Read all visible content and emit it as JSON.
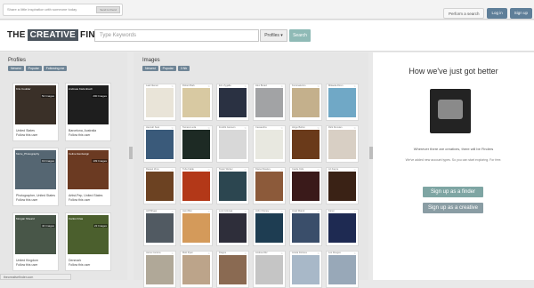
{
  "topbar": {
    "share_text": "Share a little inspiration with someone today",
    "share_button": "Send to friend",
    "perform_search": "Perform a search",
    "login": "Log in",
    "signup": "Sign up"
  },
  "header": {
    "logo_left": "THE",
    "logo_mid": "CREATIVE",
    "logo_right": "FINDER",
    "search_placeholder": "Type Keywords",
    "select_value": "Profiles",
    "search_button": "Search"
  },
  "profiles": {
    "title": "Profiles",
    "filters": [
      "Newest",
      "Popular",
      "Following me"
    ],
    "cards": [
      {
        "name": "Kris Coulder",
        "count": "52 Images",
        "location": "United States",
        "follow": "Follow this user",
        "color": "#3a3028"
      },
      {
        "name": "Andreas Kiefenbach",
        "count": "200 Images",
        "location": "Barcelona, Australia",
        "follow": "Follow this user",
        "color": "#1e1e1e"
      },
      {
        "name": "Moire_Photography",
        "count": "19 Images",
        "location": "Photographer, United States",
        "follow": "Follow this user",
        "color": "#556672"
      },
      {
        "name": "Celine Ikerdesign",
        "count": "109 Images",
        "location": "Artist-Pep, United States",
        "follow": "Follow this user",
        "color": "#6b3a22"
      },
      {
        "name": "Morgan Sheard",
        "count": "44 Images",
        "location": "United Kingdom",
        "follow": "Follow this user",
        "color": "#485648"
      },
      {
        "name": "Carlos Frias",
        "count": "22 Images",
        "location": "Denmark",
        "follow": "Follow this user",
        "color": "#4b5f2d"
      }
    ]
  },
  "images": {
    "title": "Images",
    "filters": [
      "Newest",
      "Popular",
      "3 Nb"
    ],
    "cards": [
      {
        "name": "Lael Niemer",
        "color": "#e9e4d8"
      },
      {
        "name": "Robert Bark",
        "color": "#d8c9a2"
      },
      {
        "name": "Eric Zygalla",
        "color": "#2a3142"
      },
      {
        "name": "Alex Broad",
        "color": "#a2a3a5"
      },
      {
        "name": "Kuroinaturino",
        "color": "#c4b08c"
      },
      {
        "name": "Mikaela Ahren",
        "color": "#70a8c6"
      },
      {
        "name": "Hannah Seet",
        "color": "#3a5a7a"
      },
      {
        "name": "Tamara Luda",
        "color": "#1d2a24"
      },
      {
        "name": "Fredrik Jansson",
        "color": "#d8d8d8"
      },
      {
        "name": "Cassandra",
        "color": "#e8e8e0"
      },
      {
        "name": "Hinge Bellon",
        "color": "#6a3a1a"
      },
      {
        "name": "Rick Dunstan",
        "color": "#d8cfc4"
      },
      {
        "name": "Raquel Zimo",
        "color": "#6c4222"
      },
      {
        "name": "Tubs Fable",
        "color": "#b33818"
      },
      {
        "name": "Tayler Wicker",
        "color": "#2c4650"
      },
      {
        "name": "Diana Sheeley",
        "color": "#8c5a3a"
      },
      {
        "name": "Castle Kids",
        "color": "#3a1a1a"
      },
      {
        "name": "Art Fayne",
        "color": "#3a2215"
      },
      {
        "name": "Jeff Briggs",
        "color": "#515a62"
      },
      {
        "name": "Jami Bon",
        "color": "#d49a5a"
      },
      {
        "name": "Luis Colunga",
        "color": "#2e2e3a"
      },
      {
        "name": "John Cheney",
        "color": "#1e3d52"
      },
      {
        "name": "Josef Marek",
        "color": "#3a4e6a"
      },
      {
        "name": "Karen",
        "color": "#1e2a52"
      },
      {
        "name": "Jaime Carrera",
        "color": "#b0a898"
      },
      {
        "name": "Matt Ryan",
        "color": "#bca48a"
      },
      {
        "name": "Diagne",
        "color": "#8a6a52"
      },
      {
        "name": "Andrea Ditz",
        "color": "#c5c5c5"
      },
      {
        "name": "Aniela Dolores",
        "color": "#a8b8c8"
      },
      {
        "name": "Les Rouges",
        "color": "#98a8b8"
      }
    ]
  },
  "promo": {
    "title": "How we've just got better",
    "sub1": "Wherever there are creatives, there will be Finders",
    "sub2": "We've added new account types. So you can start exploring. For free.",
    "btn_finder": "Sign up as a finder",
    "btn_creative": "Sign up as a creative"
  },
  "status_url": "thecreativefinder.com"
}
